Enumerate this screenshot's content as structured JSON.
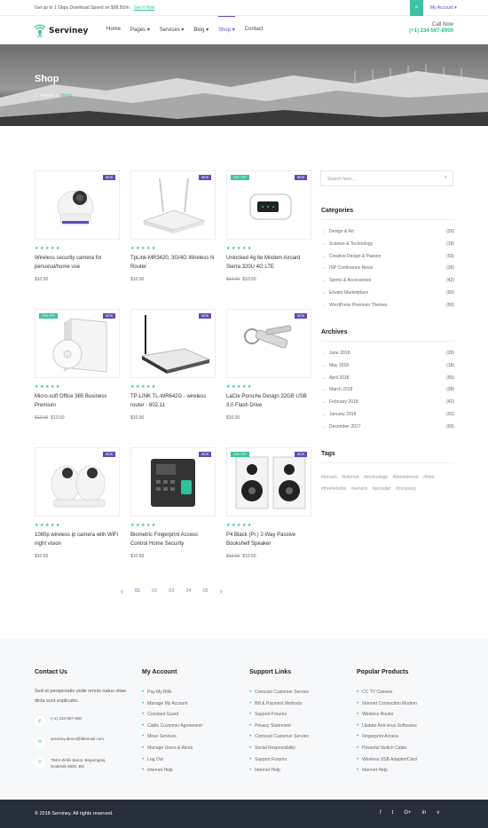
{
  "topbar": {
    "promo": "Get up to 1 Gbps Download Speed on $98.50/m",
    "promo_link": "Get It Now",
    "account": "My Account ▾"
  },
  "header": {
    "logo": "Serviney",
    "nav": [
      "Home",
      "Pages ▾",
      "Services ▾",
      "Blog ▾",
      "Shop ▾",
      "Contact"
    ],
    "call_label": "Call Now",
    "call_number": "(+1) 234-567-8900"
  },
  "hero": {
    "title": "Shop",
    "home": "Home",
    "sep": "/",
    "current": "Shop"
  },
  "products": [
    {
      "name": "Wireless security camera for personal/home use",
      "price": "$10.50",
      "old_price": "",
      "badge": "NEW",
      "discount": "",
      "stars": "★★★★★"
    },
    {
      "name": "TpLink-MR3420, 3G/4G Wireless N Router",
      "price": "$10.50",
      "old_price": "",
      "badge": "NEW",
      "discount": "",
      "stars": "★★★★★"
    },
    {
      "name": "Unlocked 4g lte Modem Aircard Sierra 320U 4G LTE",
      "price": "$10.50",
      "old_price": "$12.00",
      "badge": "NEW",
      "discount": "20% OFF",
      "stars": "★★★★★"
    },
    {
      "name": "Micro-soft Office 365 Business Premium",
      "price": "$10.50",
      "old_price": "$12.00",
      "badge": "NEW",
      "discount": "20% OFF",
      "stars": "★★★★★"
    },
    {
      "name": "TP-LINK TL-WR642G - wireless router - 802.11",
      "price": "$10.50",
      "old_price": "",
      "badge": "NEW",
      "discount": "",
      "stars": "★★★★★"
    },
    {
      "name": "LaCie Porsche Design 32GB USB 3.0 Flash Drive",
      "price": "$10.50",
      "old_price": "",
      "badge": "NEW",
      "discount": "",
      "stars": "★★★★★"
    },
    {
      "name": "1080p wireless ip camera with WiFi night vision",
      "price": "$10.50",
      "old_price": "",
      "badge": "NEW",
      "discount": "",
      "stars": "★★★★★"
    },
    {
      "name": "Biometric Fingerprint Access Control Home Security",
      "price": "$10.50",
      "old_price": "",
      "badge": "NEW",
      "discount": "",
      "stars": "★★★★★"
    },
    {
      "name": "P4 Black (Pr.) 2-Way Passive Bookshelf Speaker",
      "price": "$10.50",
      "old_price": "$12.00",
      "badge": "NEW",
      "discount": "20% OFF",
      "stars": "★★★★★"
    }
  ],
  "pagination": {
    "prev": "‹",
    "pages": [
      "01",
      "02",
      "03",
      "04",
      "05"
    ],
    "next": "›"
  },
  "sidebar": {
    "search_placeholder": "Search here...",
    "categories_title": "Categories",
    "categories": [
      {
        "label": "Design & Art",
        "count": "(29)"
      },
      {
        "label": "Science & Technology",
        "count": "(18)"
      },
      {
        "label": "Creative Design & Passon",
        "count": "(59)"
      },
      {
        "label": "ISP Conference News",
        "count": "(38)"
      },
      {
        "label": "Sports & Accessories",
        "count": "(42)"
      },
      {
        "label": "Envato Marketplace",
        "count": "(93)"
      },
      {
        "label": "WordPress Premium Themes",
        "count": "(69)"
      }
    ],
    "archives_title": "Archives",
    "archives": [
      {
        "label": "June 2018",
        "count": "(29)"
      },
      {
        "label": "May 2018",
        "count": "(18)"
      },
      {
        "label": "April 2018",
        "count": "(59)"
      },
      {
        "label": "March 2018",
        "count": "(38)"
      },
      {
        "label": "February 2018",
        "count": "(42)"
      },
      {
        "label": "January 2018",
        "count": "(93)"
      },
      {
        "label": "December 2017",
        "count": "(69)"
      }
    ],
    "tags_title": "Tags",
    "tags": [
      "#envato",
      "#internet",
      "#technology",
      "#themeforest",
      "#html",
      "#themelooks",
      "#service",
      "#provider",
      "#company"
    ]
  },
  "footer": {
    "contact_title": "Contact Us",
    "contact_text": "Sed ut perspiciatis unde omnis natus vitae dicta sunt explicabo.",
    "phone": "(+1) 234-567-800",
    "email": "serviney.demo@fakemail.com",
    "address": "784/4 Zirbili Bazar, Begumganj, Noakhali-3800, BD",
    "account_title": "My Account",
    "account_items": [
      "Pay My Bills",
      "Manage My Account",
      "Constant Guard",
      "Cable Customer Agreement",
      "Move Services",
      "Manage Users & Alerts",
      "Log Out",
      "Internet Help"
    ],
    "support_title": "Support Links",
    "support_items": [
      "Comcast Customer Service",
      "Bill & Payment Methods",
      "Support Forums",
      "Privacy Statement",
      "Comcast Customer Service",
      "Social Responsibility",
      "Support Forums",
      "Internet Help"
    ],
    "products_title": "Popular Products",
    "products_items": [
      "CC TV Camera",
      "Internet Connection Modem",
      "Wireless Router",
      "Update Anti-virus Softwares",
      "Fingerprint Access",
      "Powerful Switch Cable",
      "Wireless USB Adapter/Card",
      "Internet Help"
    ],
    "copyright": "© 2018 Serviney. All rights reserved.",
    "social": [
      "f",
      "t",
      "G+",
      "in",
      "v"
    ]
  },
  "colors": {
    "accent": "#3fc1a0",
    "brand": "#5a4fb6",
    "dark": "#262e3a"
  }
}
